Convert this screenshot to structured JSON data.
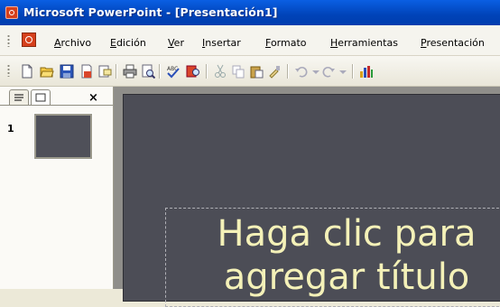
{
  "window": {
    "title": "Microsoft PowerPoint - [Presentación1]"
  },
  "menubar": {
    "items": [
      "Archivo",
      "Edición",
      "Ver",
      "Insertar",
      "Formato",
      "Herramientas",
      "Presentación"
    ]
  },
  "toolbar": {
    "buttons": [
      "new-icon",
      "open-icon",
      "save-icon",
      "permission-icon",
      "email-icon",
      "print-icon",
      "print-preview-icon",
      "spelling-icon",
      "research-icon",
      "cut-icon",
      "copy-icon",
      "paste-icon",
      "format-painter-icon",
      "undo-icon",
      "redo-icon",
      "chart-icon"
    ]
  },
  "panel": {
    "slide_number": "1",
    "close_glyph": "×"
  },
  "slide": {
    "title_placeholder": "Haga clic para agregar título",
    "background": "#4c4d56",
    "text_color": "#f4f1b8"
  }
}
